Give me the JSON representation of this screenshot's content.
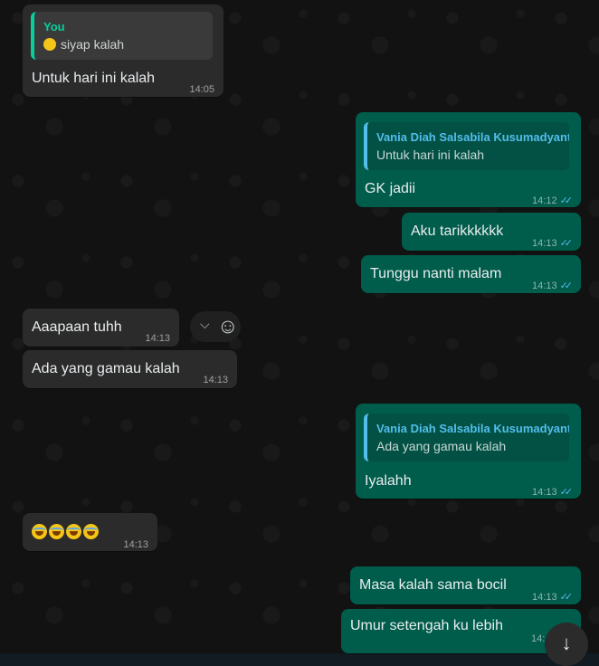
{
  "messages": [
    {
      "id": "m1",
      "dir": "in",
      "quote": {
        "author": "You",
        "text": "siyap kalah",
        "emoji": "smiling-face-emoji"
      },
      "text": "Untuk hari ini kalah",
      "time": "14:05"
    },
    {
      "id": "m2",
      "dir": "out",
      "quote": {
        "author": "Vania Diah Salsabila Kusumadyanta",
        "text": "Untuk hari ini kalah"
      },
      "text": "GK jadii",
      "time": "14:12",
      "ticks": "✓✓"
    },
    {
      "id": "m3",
      "dir": "out",
      "text": "Aku tarikkkkkk",
      "time": "14:13",
      "ticks": "✓✓"
    },
    {
      "id": "m4",
      "dir": "out",
      "text": "Tunggu nanti malam",
      "time": "14:13",
      "ticks": "✓✓"
    },
    {
      "id": "m5",
      "dir": "in",
      "text": "Aaapaan tuhh",
      "time": "14:13"
    },
    {
      "id": "m6",
      "dir": "in",
      "text": "Ada yang gamau kalah",
      "time": "14:13"
    },
    {
      "id": "m7",
      "dir": "out",
      "quote": {
        "author": "Vania Diah Salsabila Kusumadyanta",
        "text": "Ada yang gamau kalah"
      },
      "text": "Iyalahh",
      "time": "14:13",
      "ticks": "✓✓"
    },
    {
      "id": "m8",
      "dir": "in",
      "emojis": [
        "rolling-laughing-emoji",
        "rolling-laughing-emoji",
        "rolling-laughing-emoji",
        "rolling-laughing-emoji"
      ],
      "time": "14:13"
    },
    {
      "id": "m9",
      "dir": "out",
      "text": "Masa kalah sama bocil",
      "time": "14:13",
      "ticks": "✓✓"
    },
    {
      "id": "m10",
      "dir": "out",
      "text": "Umur setengah ku lebih",
      "time": "14:"
    }
  ],
  "hover_actions": {
    "chevron": "⌵",
    "reaction": "☺"
  },
  "scroll_button": {
    "icon": "↓"
  },
  "colors": {
    "incoming_bubble": "#2b2b2b",
    "outgoing_bubble": "#005c4b",
    "quote_author_you": "#06cf9c",
    "quote_author_other": "#53bdeb",
    "read_ticks": "#53bdeb"
  }
}
